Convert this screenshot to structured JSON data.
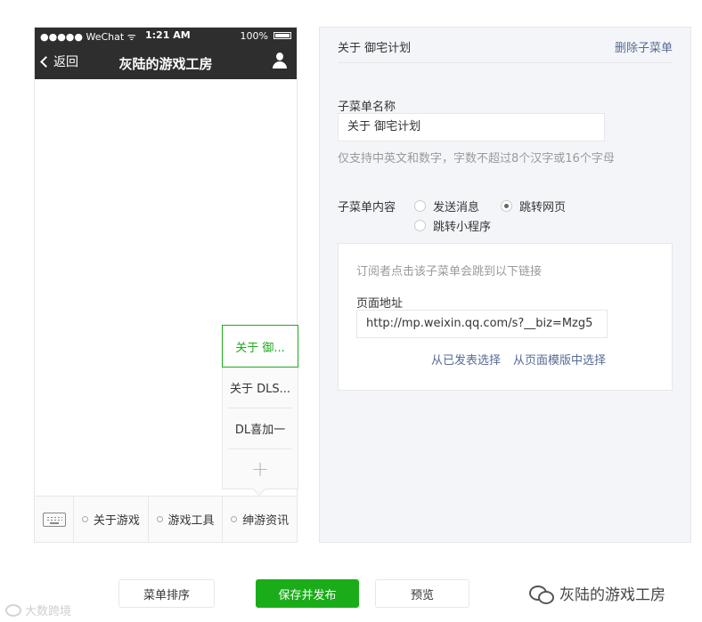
{
  "phone": {
    "status": {
      "carrier": "●●●●● WeChat ᯤ",
      "time": "1:21 AM",
      "battery": "100%"
    },
    "nav": {
      "back_label": "返回",
      "title": "灰陆的游戏工房"
    },
    "menu": {
      "items": [
        {
          "label": "关于游戏"
        },
        {
          "label": "游戏工具"
        },
        {
          "label": "绅游资讯"
        }
      ]
    },
    "submenu": {
      "items": [
        {
          "label": "关于 御..."
        },
        {
          "label": "关于 DLS..."
        },
        {
          "label": "DL喜加一"
        }
      ],
      "add_symbol": "+"
    }
  },
  "panel": {
    "title": "关于 御宅计划",
    "delete_label": "删除子菜单",
    "name_label": "子菜单名称",
    "name_value": "关于 御宅计划",
    "name_hint": "仅支持中英文和数字，字数不超过8个汉字或16个字母",
    "content_label": "子菜单内容",
    "options": [
      {
        "label": "发送消息",
        "checked": false
      },
      {
        "label": "跳转网页",
        "checked": true
      },
      {
        "label": "跳转小程序",
        "checked": false
      }
    ],
    "link_hint": "订阅者点击该子菜单会跳到以下链接",
    "url_label": "页面地址",
    "url_value": "http://mp.weixin.qq.com/s?__biz=Mzg5",
    "choose_published": "从已发表选择",
    "choose_template": "从页面模版中选择"
  },
  "footer": {
    "sort_label": "菜单排序",
    "publish_label": "保存并发布",
    "preview_label": "预览"
  },
  "watermarks": {
    "left": "大数跨境",
    "right": "灰陆的游戏工房"
  },
  "colors": {
    "accent": "#1aad19",
    "link": "#576b95",
    "navbar": "#2e2e2e"
  }
}
